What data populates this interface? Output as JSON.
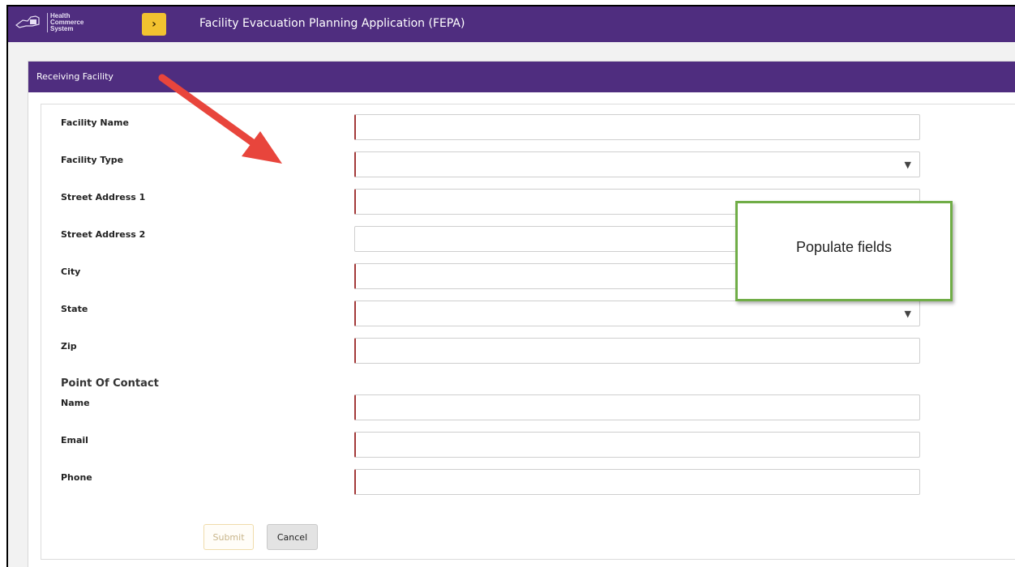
{
  "header": {
    "logo_text": [
      "Health",
      "Commerce",
      "System"
    ],
    "menu_icon": "chevron-right",
    "app_title": "Facility Evacuation Planning Application (FEPA)"
  },
  "panel": {
    "title": "Receiving Facility"
  },
  "form": {
    "facility_name_label": "Facility Name",
    "facility_type_label": "Facility Type",
    "street1_label": "Street Address 1",
    "street2_label": "Street Address 2",
    "city_label": "City",
    "state_label": "State",
    "zip_label": "Zip",
    "poc_section_label": "Point Of Contact",
    "name_label": "Name",
    "email_label": "Email",
    "phone_label": "Phone",
    "dropdown_caret": "▼"
  },
  "buttons": {
    "submit": "Submit",
    "cancel": "Cancel"
  },
  "annotation": {
    "callout_text": "Populate fields"
  },
  "colors": {
    "header_bg": "#4f2d7f",
    "menu_button": "#f2c230",
    "required_marker": "#a33a3a",
    "callout_border": "#70ad47",
    "arrow": "#e8453c"
  }
}
